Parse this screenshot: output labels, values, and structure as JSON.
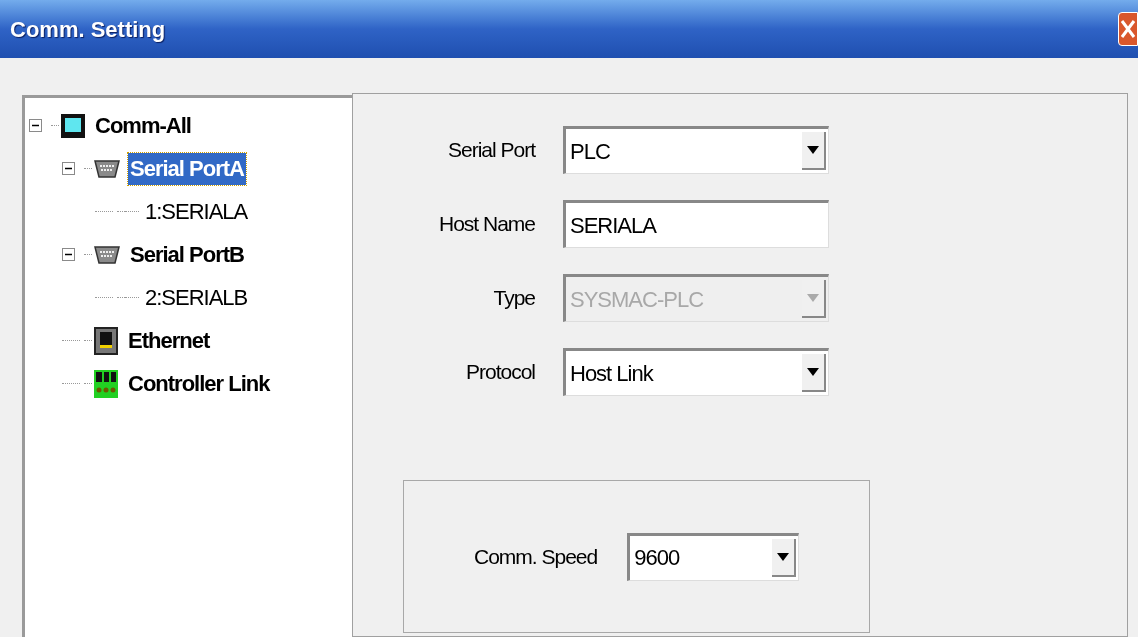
{
  "window": {
    "title": "Comm. Setting"
  },
  "tree": [
    {
      "label": "Comm-All",
      "kind": "root",
      "expanded": true,
      "selected": false,
      "children": [
        {
          "label": "Serial PortA",
          "kind": "serial",
          "expanded": true,
          "selected": true,
          "children": [
            {
              "label": "1:SERIALA",
              "selected": false
            }
          ]
        },
        {
          "label": "Serial PortB",
          "kind": "serial",
          "expanded": true,
          "selected": false,
          "children": [
            {
              "label": "2:SERIALB",
              "selected": false
            }
          ]
        },
        {
          "label": "Ethernet",
          "kind": "ethernet",
          "selected": false
        },
        {
          "label": "Controller Link",
          "kind": "controller_link",
          "selected": false
        }
      ]
    }
  ],
  "form": [
    {
      "label": "Serial Port",
      "kind": "dropdown",
      "value": "PLC",
      "disabled": false
    },
    {
      "label": "Host Name",
      "kind": "text",
      "value": "SERIALA",
      "disabled": false
    },
    {
      "label": "Type",
      "kind": "dropdown",
      "value": "SYSMAC-PLC",
      "disabled": true
    },
    {
      "label": "Protocol",
      "kind": "dropdown",
      "value": "Host Link",
      "disabled": false
    }
  ],
  "speed": {
    "label": "Comm. Speed",
    "value": "9600",
    "disabled": false
  }
}
